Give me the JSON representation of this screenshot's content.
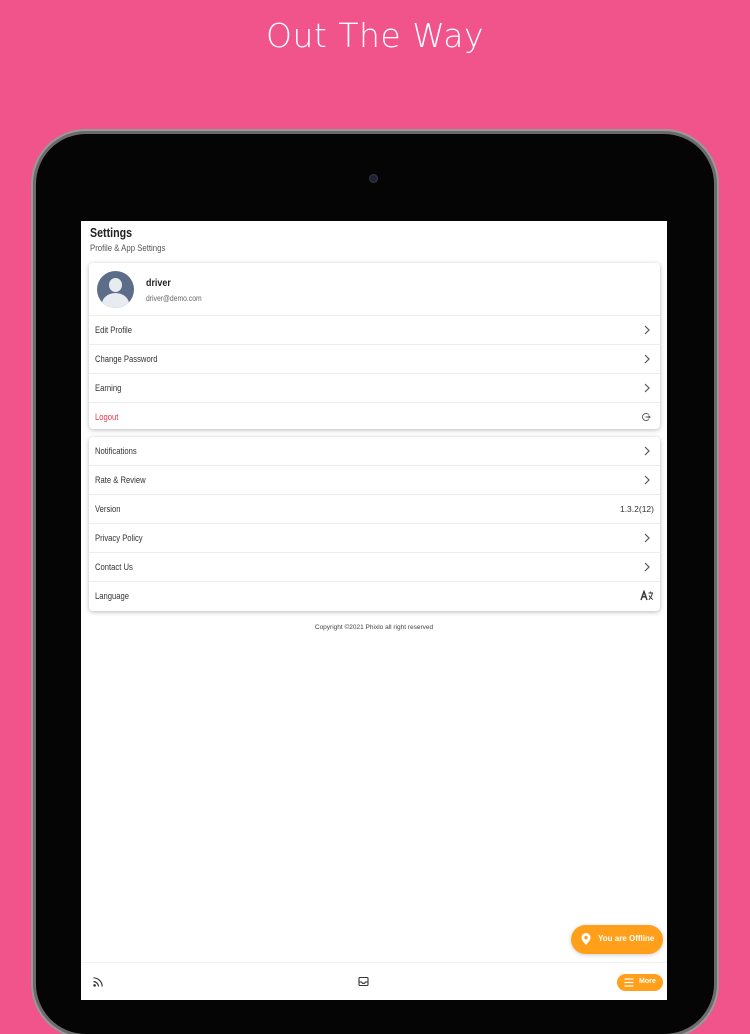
{
  "promo": {
    "title": "Out The Way"
  },
  "settings": {
    "title": "Settings",
    "subtitle": "Profile & App Settings"
  },
  "profile": {
    "name": "driver",
    "email": "driver@demo.com"
  },
  "account_items": [
    {
      "label": "Edit Profile"
    },
    {
      "label": "Change Password"
    },
    {
      "label": "Earning"
    },
    {
      "label": "Logout"
    }
  ],
  "app_items": [
    {
      "label": "Notifications"
    },
    {
      "label": "Rate & Review"
    },
    {
      "label": "Version",
      "value": "1.3.2(12)"
    },
    {
      "label": "Privacy Policy"
    },
    {
      "label": "Contact Us"
    },
    {
      "label": "Language",
      "icon": "language-icon",
      "glyph": "Á "
    }
  ],
  "footer": {
    "copyright": "Copyright ©2021 Phixlo all right reserved"
  },
  "status": {
    "offline_label": "You are Offline"
  },
  "bottom_nav": {
    "more_label": "More"
  },
  "colors": {
    "background": "#f0548a",
    "accent": "#ff9f1a",
    "logout": "#e03a4e"
  }
}
